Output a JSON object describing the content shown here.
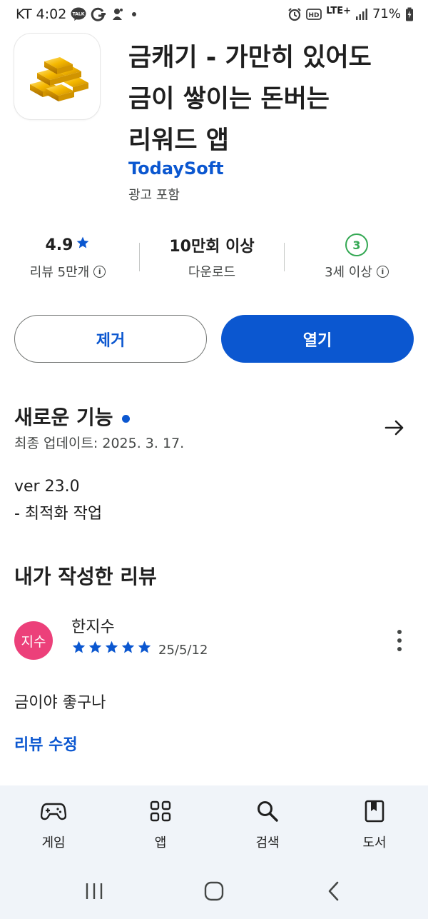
{
  "status_bar": {
    "carrier_time": "KT 4:02",
    "kakao_label": "TALK",
    "network": "LTE+",
    "battery": "71%"
  },
  "app": {
    "title_lines": [
      "금캐기 - 가만히 있어도",
      "금이 쌓이는 돈버는",
      "리워드 앱"
    ],
    "developer": "TodaySoft",
    "ads_label": "광고 포함",
    "icon": "gold-bars-icon"
  },
  "stats": {
    "rating": "4.9",
    "reviews_label": "리뷰 5만개",
    "downloads": "10만회 이상",
    "downloads_label": "다운로드",
    "age_badge": "3",
    "age_label": "3세 이상"
  },
  "buttons": {
    "uninstall": "제거",
    "open": "열기"
  },
  "whats_new": {
    "title": "새로운 기능",
    "updated": "최종 업데이트: 2025. 3. 17.",
    "version": "ver 23.0",
    "note": "- 최적화 작업"
  },
  "my_review": {
    "title": "내가 작성한 리뷰",
    "avatar_text": "지수",
    "avatar_color": "#ec407a",
    "reviewer": "한지수",
    "stars": 5,
    "date": "25/5/12",
    "text": "금이야 좋구나",
    "edit_label": "리뷰 수정"
  },
  "bottom_nav": {
    "items": [
      {
        "label": "게임",
        "icon": "gamepad-icon"
      },
      {
        "label": "앱",
        "icon": "apps-grid-icon"
      },
      {
        "label": "검색",
        "icon": "search-icon"
      },
      {
        "label": "도서",
        "icon": "book-icon"
      }
    ]
  },
  "colors": {
    "accent": "#0b57d0",
    "age_green": "#34a853",
    "nav_bg": "#f0f4f9"
  }
}
